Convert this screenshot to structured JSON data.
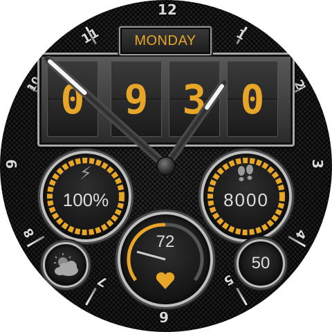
{
  "day": "MONDAY",
  "time_digits": [
    "0",
    "9",
    "3",
    "0"
  ],
  "hour_marks": [
    "12",
    "1",
    "2",
    "3",
    "4",
    "5",
    "6",
    "7",
    "8",
    "9",
    "10",
    "11"
  ],
  "battery": {
    "value": "100%",
    "level": 1.0,
    "icon": "bolt-icon"
  },
  "steps": {
    "value": "8000",
    "icon": "footprints-icon"
  },
  "heart_rate": {
    "value": "72",
    "icon": "heart-icon"
  },
  "weather": {
    "icon": "partly-cloudy-icon"
  },
  "small_dial": {
    "value": "50"
  },
  "colors": {
    "accent": "#e8a629",
    "text": "#dedede",
    "bezel": "#bfbfbf"
  },
  "hands": {
    "hour": "09",
    "minute": "30"
  }
}
